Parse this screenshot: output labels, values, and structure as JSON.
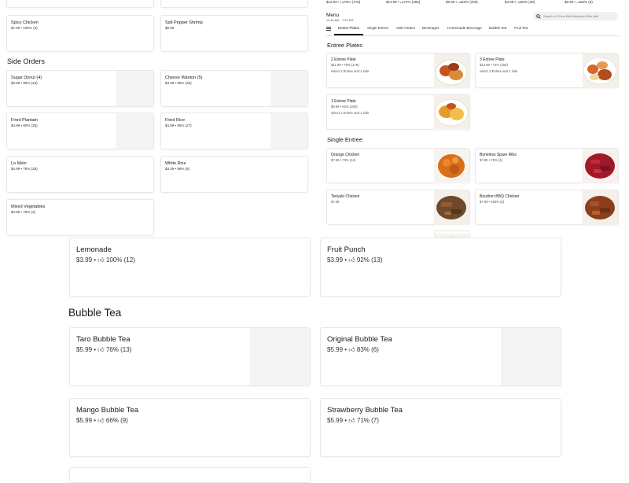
{
  "top_strip": {
    "items": [
      {
        "price": "$12.99",
        "stat": "79% (178)"
      },
      {
        "price": "$13.99",
        "stat": "74% (255)"
      },
      {
        "price": "$9.99",
        "stat": "82% (209)"
      },
      {
        "price": "$4.99",
        "stat": "96% (26)"
      },
      {
        "price": "$5.99",
        "stat": "66% (9)"
      }
    ]
  },
  "left_menu": {
    "top_items": [
      {
        "name": "Spicy Chicken",
        "meta": "$7.99 • 100% (3)"
      },
      {
        "name": "Salt Pepper Shrimp",
        "meta": "$9.99"
      }
    ],
    "side_orders_title": "Side Orders",
    "side_orders": [
      {
        "name": "Sugar Donut (4)",
        "meta": "$3.99 • 88% (43)"
      },
      {
        "name": "Cheese Wanton (5)",
        "meta": "$4.99 • 96% (26)"
      },
      {
        "name": "Fried Plantain",
        "meta": "$4.99 • 80% (25)"
      },
      {
        "name": "Fried Rice",
        "meta": "$4.99 • 85% (27)"
      },
      {
        "name": "Lo Mein",
        "meta": "$4.99 • 78% (28)"
      },
      {
        "name": "White Rice",
        "meta": "$3.39 • 88% (9)"
      },
      {
        "name": "Mixed Vegetables",
        "meta": "$4.99 • 75% (4)"
      }
    ]
  },
  "menu_panel": {
    "title": "Menu",
    "hours": "10:45 AM – 7:40 PM",
    "search_placeholder": "Search in China Wok Buckland Hills Mall",
    "nav": [
      "Entree Plates",
      "Single Entree",
      "Side Orders",
      "Beverages",
      "Homemade Beverage",
      "Bubble Tea",
      "Fruit Tea"
    ],
    "active_nav": "Entree Plates",
    "entree_plates_title": "Entree Plates",
    "entree_plates": [
      {
        "name": "2 Entree Plate",
        "meta": "$11.99 • 79% (178)",
        "desc": "select 2 Entree and 1 side"
      },
      {
        "name": "3 Entree Plate",
        "meta": "$13.99 • 74% (255)",
        "desc": "select 3 Entree and 1 side"
      },
      {
        "name": "1 Entree Plate",
        "meta": "$9.99 • 82% (209)",
        "desc": "select 1 Entree and 1 side"
      }
    ],
    "single_entree_title": "Single Entree",
    "single_entree": [
      {
        "name": "Orange Chicken",
        "meta": "$7.99 • 79% (12)"
      },
      {
        "name": "Boneless Spare Ribs",
        "meta": "$7.99 • 75% (4)"
      },
      {
        "name": "Teriyaki Chicken",
        "meta": "$7.99"
      },
      {
        "name": "Bourbon BBQ Chicken",
        "meta": "$7.99 • 100% (6)"
      }
    ]
  },
  "beverages": [
    {
      "name": "Lemonade",
      "price": "$3.99",
      "stat": "100% (12)"
    },
    {
      "name": "Fruit Punch",
      "price": "$3.99",
      "stat": "92% (13)"
    }
  ],
  "bubble_tea": {
    "title": "Bubble Tea",
    "items": [
      {
        "name": "Taro Bubble Tea",
        "price": "$5.99",
        "stat": "76% (13)"
      },
      {
        "name": "Original Bubble Tea",
        "price": "$5.99",
        "stat": "83% (6)"
      },
      {
        "name": "Mango Bubble Tea",
        "price": "$5.99",
        "stat": "66% (9)"
      },
      {
        "name": "Strawberry Bubble Tea",
        "price": "$5.99",
        "stat": "71% (7)"
      }
    ]
  }
}
